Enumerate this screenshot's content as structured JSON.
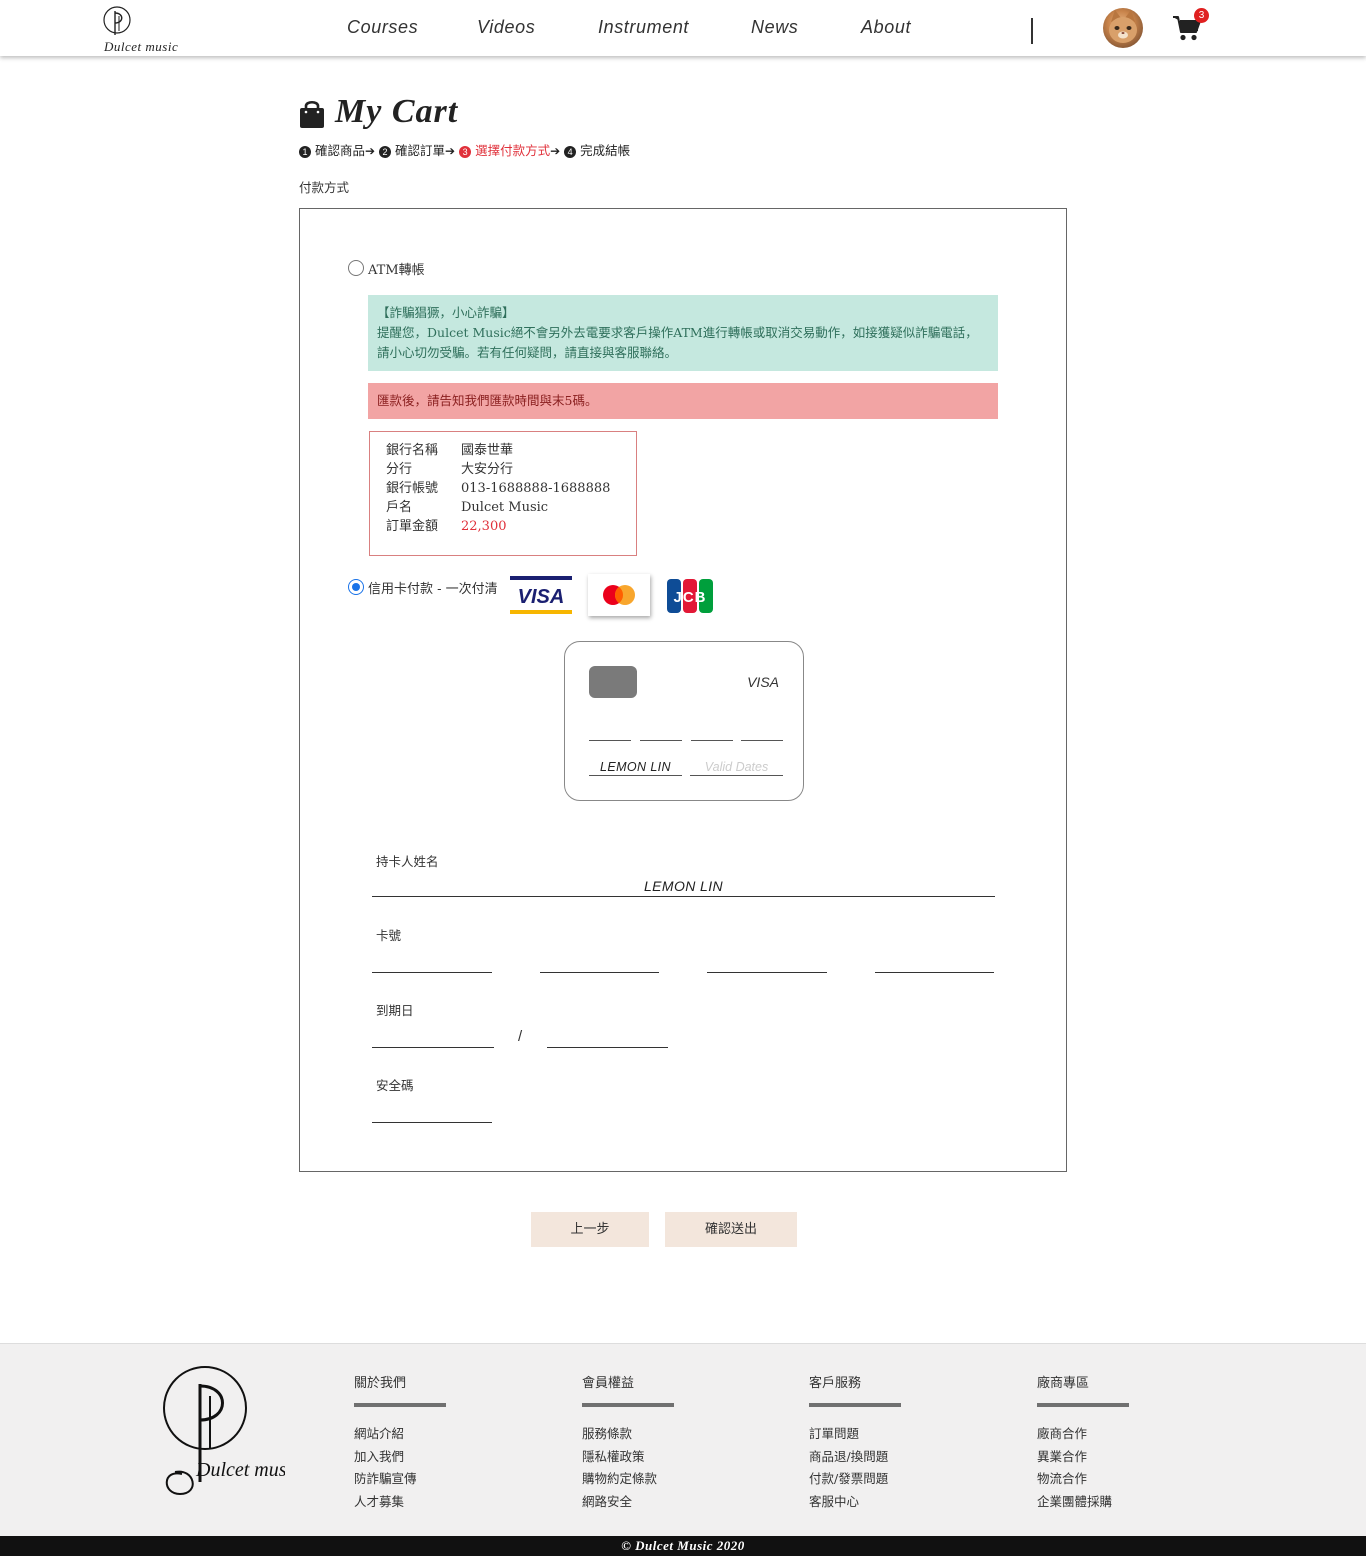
{
  "header": {
    "logo_text": "Dulcet music",
    "nav": [
      "Courses",
      "Videos",
      "Instrument",
      "News",
      "About"
    ],
    "cart_count": "3"
  },
  "page": {
    "title": "My Cart",
    "steps": [
      {
        "num": "1",
        "label": "確認商品"
      },
      {
        "num": "2",
        "label": "確認訂單"
      },
      {
        "num": "3",
        "label": "選擇付款方式"
      },
      {
        "num": "4",
        "label": "完成結帳"
      }
    ],
    "active_step": 3,
    "section_label": "付款方式"
  },
  "payment": {
    "atm_label": "ATM轉帳",
    "atm_selected": false,
    "notice_green_title": "【詐騙猖獗，小心詐騙】",
    "notice_green_line1": "提醒您，Dulcet Music絕不會另外去電要求客戶操作ATM進行轉帳或取消交易動作，如接獲疑似詐騙電話，",
    "notice_green_line2": "請小心切勿受騙。若有任何疑問，請直接與客服聯絡。",
    "notice_red": "匯款後，請告知我們匯款時間與末5碼。",
    "bank": [
      {
        "k": "銀行名稱",
        "v": "國泰世華"
      },
      {
        "k": "分行",
        "v": "大安分行"
      },
      {
        "k": "銀行帳號",
        "v": "013-1688888-1688888"
      },
      {
        "k": "戶名",
        "v": "Dulcet Music"
      },
      {
        "k": "訂單金額",
        "v": "22,300"
      }
    ],
    "credit_label": "信用卡付款 - 一次付清",
    "credit_selected": true,
    "brands": [
      "visa-logo",
      "mastercard-logo",
      "jcb-logo"
    ],
    "visa_text": "VISA",
    "jcb_text": "JCB",
    "card_preview": {
      "brand": "VISA",
      "name": "LEMON LIN",
      "dates_placeholder": "Valid Dates"
    },
    "form": {
      "holder_label": "持卡人姓名",
      "holder_value": "LEMON LIN",
      "card_number_label": "卡號",
      "expiry_label": "到期日",
      "expiry_separator": "/",
      "cvv_label": "安全碼"
    }
  },
  "buttons": {
    "prev": "上一步",
    "submit": "確認送出"
  },
  "footer": {
    "logo_text": "Dulcet music",
    "columns": [
      {
        "head": "關於我們",
        "items": [
          "網站介紹",
          "加入我們",
          "防詐騙宣傳",
          "人才募集"
        ]
      },
      {
        "head": "會員權益",
        "items": [
          "服務條款",
          "隱私權政策",
          "購物約定條款",
          "網路安全"
        ]
      },
      {
        "head": "客戶服務",
        "items": [
          "訂單問題",
          "商品退/換問題",
          "付款/發票問題",
          "客服中心"
        ]
      },
      {
        "head": "廠商專區",
        "items": [
          "廠商合作",
          "異業合作",
          "物流合作",
          "企業團體採購"
        ]
      }
    ],
    "copyright": "© Dulcet Music 2020"
  },
  "colors": {
    "accent_red": "#e0303a",
    "notice_green_bg": "#c5e8df",
    "notice_red_bg": "#f2a4a4",
    "button_bg": "#f3e6dc",
    "radio_blue": "#1a73e8"
  }
}
